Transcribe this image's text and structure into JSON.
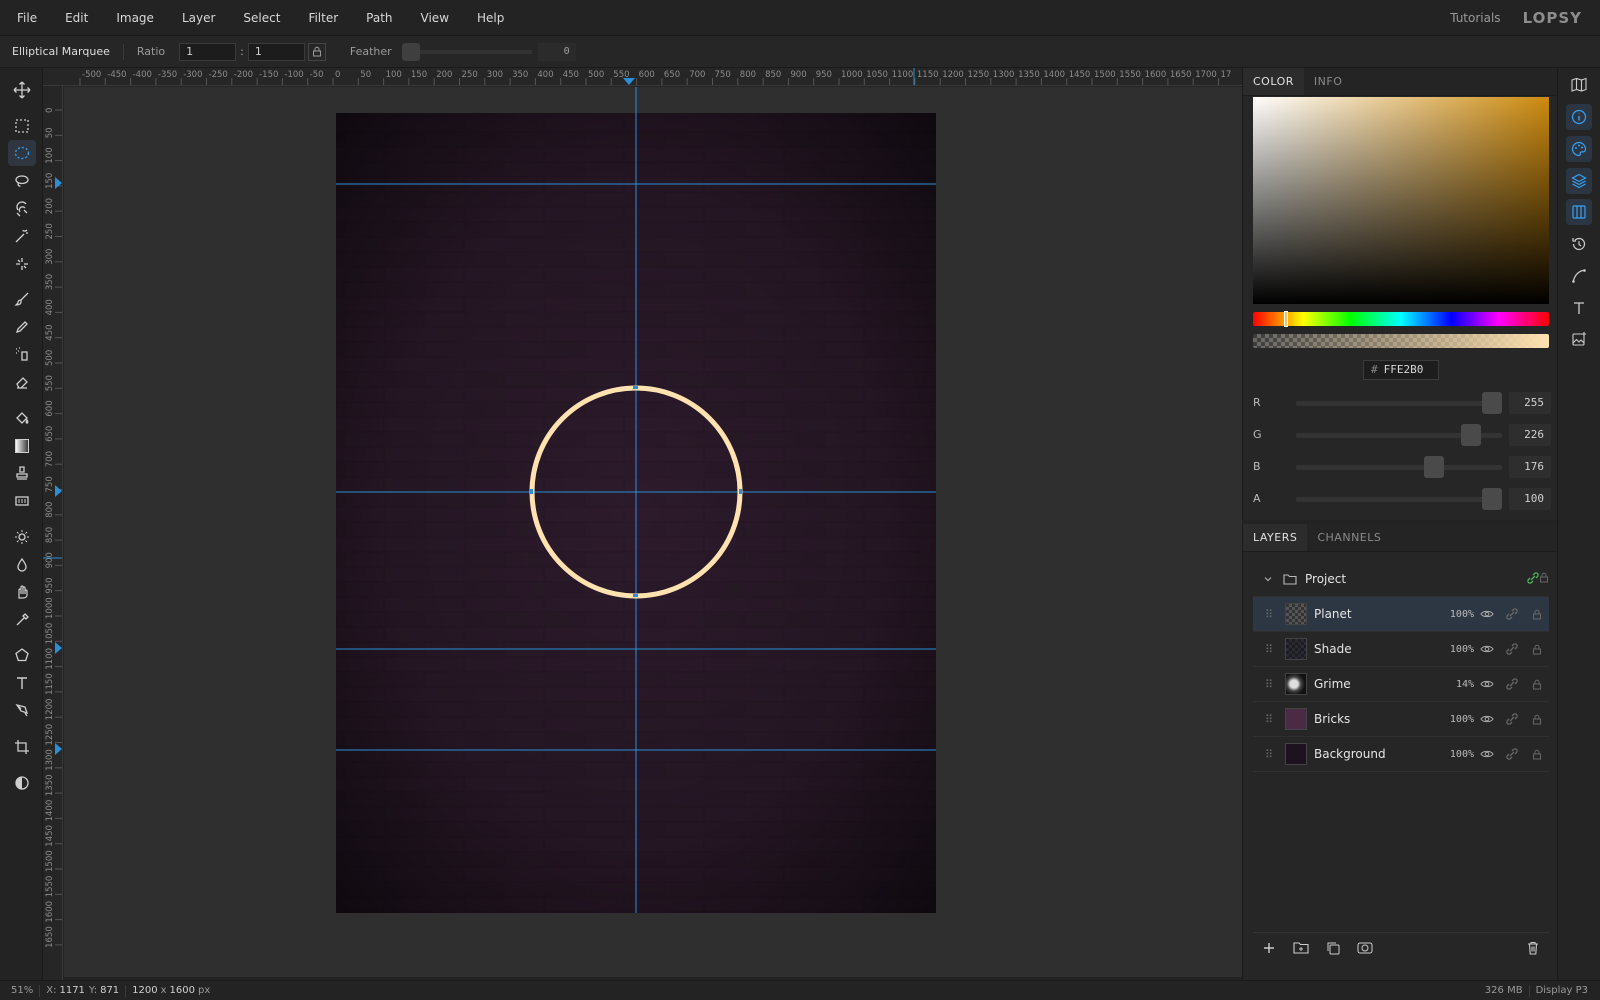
{
  "menu": [
    "File",
    "Edit",
    "Image",
    "Layer",
    "Select",
    "Filter",
    "Path",
    "View",
    "Help"
  ],
  "header": {
    "tutorials": "Tutorials",
    "logo": "LOPSY"
  },
  "options": {
    "tool_name": "Elliptical Marquee",
    "ratio_label": "Ratio",
    "ratio_w": "1",
    "ratio_h": "1",
    "ratio_sep": ":",
    "feather_label": "Feather",
    "feather_value": "0"
  },
  "tools": [
    "move-icon",
    "rect-marquee-icon",
    "ellipse-marquee-icon",
    "lasso-icon",
    "magnetic-lasso-icon",
    "magic-wand-icon",
    "quick-select-icon",
    "brush-icon",
    "pencil-icon",
    "spray-icon",
    "eraser-icon",
    "bucket-icon",
    "gradient-icon",
    "stamp-icon",
    "pattern-icon",
    "dodge-icon",
    "blur-icon",
    "smudge-icon",
    "eyedropper-icon",
    "shape-icon",
    "type-icon",
    "pen-icon",
    "crop-icon",
    "contrast-icon"
  ],
  "active_tool": "ellipse-marquee-icon",
  "ruler": {
    "top_labels": [
      "-500",
      "-450",
      "-400",
      "-350",
      "-300",
      "-250",
      "-200",
      "-150",
      "-100",
      "-50",
      "0",
      "50",
      "100",
      "150",
      "200",
      "250",
      "300",
      "350",
      "400",
      "450",
      "500",
      "550",
      "600",
      "650",
      "700",
      "750",
      "800",
      "850",
      "900",
      "950",
      "1000",
      "1050",
      "1100",
      "1150",
      "1200",
      "1250",
      "1300",
      "1350",
      "1400",
      "1450",
      "1500",
      "1550",
      "1600",
      "1650",
      "1700",
      "17"
    ],
    "left_labels": [
      "0",
      "50",
      "100",
      "150",
      "200",
      "250",
      "300",
      "350",
      "400",
      "450",
      "500",
      "550",
      "600",
      "650",
      "700",
      "750",
      "800",
      "850",
      "900",
      "950",
      "1000",
      "1050",
      "1100",
      "1150",
      "1200",
      "1250",
      "1300",
      "1350",
      "1400",
      "1450",
      "1500",
      "1550",
      "1600",
      "1650"
    ]
  },
  "color_panel": {
    "tabs": [
      "COLOR",
      "INFO"
    ],
    "active_tab": "COLOR",
    "hex": "FFE2B0",
    "hash": "#",
    "hue_fraction": 0.105,
    "channels": [
      {
        "label": "R",
        "value": "255",
        "fraction": 1.0
      },
      {
        "label": "G",
        "value": "226",
        "fraction": 0.886
      },
      {
        "label": "B",
        "value": "176",
        "fraction": 0.69
      },
      {
        "label": "A",
        "value": "100",
        "fraction": 1.0
      }
    ],
    "current_color": "#FFE2B0"
  },
  "layers_panel": {
    "tabs": [
      "LAYERS",
      "CHANNELS"
    ],
    "active_tab": "LAYERS",
    "group": {
      "name": "Project"
    },
    "layers": [
      {
        "name": "Planet",
        "opacity": "100%",
        "selected": true
      },
      {
        "name": "Shade",
        "opacity": "100%",
        "selected": false
      },
      {
        "name": "Grime",
        "opacity": "14%",
        "selected": false
      },
      {
        "name": "Bricks",
        "opacity": "100%",
        "selected": false
      },
      {
        "name": "Background",
        "opacity": "100%",
        "selected": false
      }
    ]
  },
  "right_rail": [
    "map-icon",
    "info-icon",
    "palette-icon",
    "layers-icon",
    "columns-icon",
    "history-icon",
    "path-icon",
    "text-icon",
    "image-icon"
  ],
  "status": {
    "zoom": "51%",
    "x_label": "X:",
    "x": "1171",
    "y_label": "Y:",
    "y": "871",
    "size_w": "1200",
    "size_sep": "x",
    "size_h": "1600",
    "size_unit": "px",
    "memory": "326 MB",
    "profile": "Display P3"
  },
  "colors": {
    "accent": "#1e9df1",
    "guide": "#2a8fd6",
    "canvas_bg": "#211420",
    "ring": "#FFE2B0"
  }
}
